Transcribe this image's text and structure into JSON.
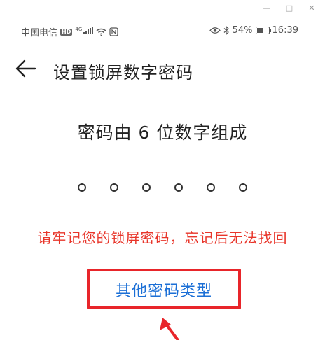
{
  "window": {
    "minimize_icon": "minimize-icon",
    "maximize_icon": "maximize-icon",
    "close_icon": "close-icon",
    "minimize_glyph": "—",
    "maximize_glyph": "□",
    "close_glyph": "✕"
  },
  "status_bar": {
    "carrier": "中国电信",
    "hd": "HD",
    "network": "4G",
    "battery_percent": "54%",
    "battery_level": 0.54,
    "time": "16:39"
  },
  "header": {
    "title": "设置锁屏数字密码"
  },
  "main": {
    "instruction": "密码由 6 位数字组成",
    "pin_length": 6,
    "warning": "请牢记您的锁屏密码，忘记后无法找回",
    "other_types_label": "其他密码类型"
  },
  "colors": {
    "warning": "#e8352a",
    "link": "#1b6fd6",
    "highlight_box": "#e8252a"
  }
}
